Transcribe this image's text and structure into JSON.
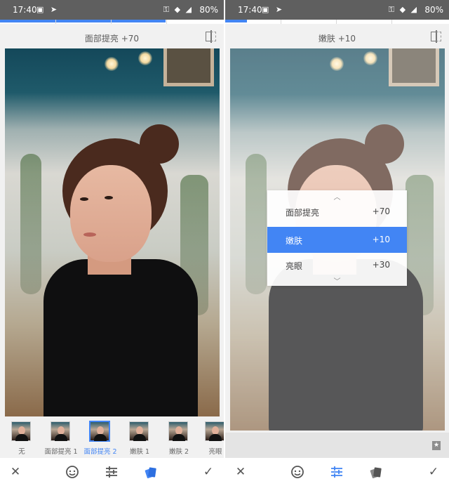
{
  "left": {
    "status": {
      "time": "17:40",
      "left_icons": "▣ ➤",
      "right_icons": "⚿ ◆ ◢",
      "battery": "80%"
    },
    "title": "面部提亮 +70",
    "filters": [
      {
        "label": "无",
        "selected": false
      },
      {
        "label": "面部提亮 1",
        "selected": false
      },
      {
        "label": "面部提亮 2",
        "selected": true
      },
      {
        "label": "嫩肤 1",
        "selected": false
      },
      {
        "label": "嫩肤 2",
        "selected": false
      },
      {
        "label": "亮眼",
        "selected": false
      }
    ],
    "toolbar": {
      "close": "✕",
      "confirm": "✓",
      "active": "styles"
    }
  },
  "right": {
    "status": {
      "time": "17:40",
      "left_icons": "▣ ➤",
      "right_icons": "⚿ ◆ ◢",
      "battery": "80%"
    },
    "title": "嫩肤 +10",
    "popup": {
      "up_chevron": "︿",
      "down_chevron": "﹀",
      "rows": [
        {
          "name": "面部提亮",
          "value": "+70",
          "active": false
        },
        {
          "name": "嫩肤",
          "value": "+10",
          "active": true
        },
        {
          "name": "亮眼",
          "value": "+30",
          "active": false
        }
      ]
    },
    "star_glyph": "★",
    "toolbar": {
      "close": "✕",
      "confirm": "✓",
      "active": "adjust"
    }
  },
  "colors": {
    "accent": "#4285f4",
    "statusbar": "#5f5f5f"
  }
}
